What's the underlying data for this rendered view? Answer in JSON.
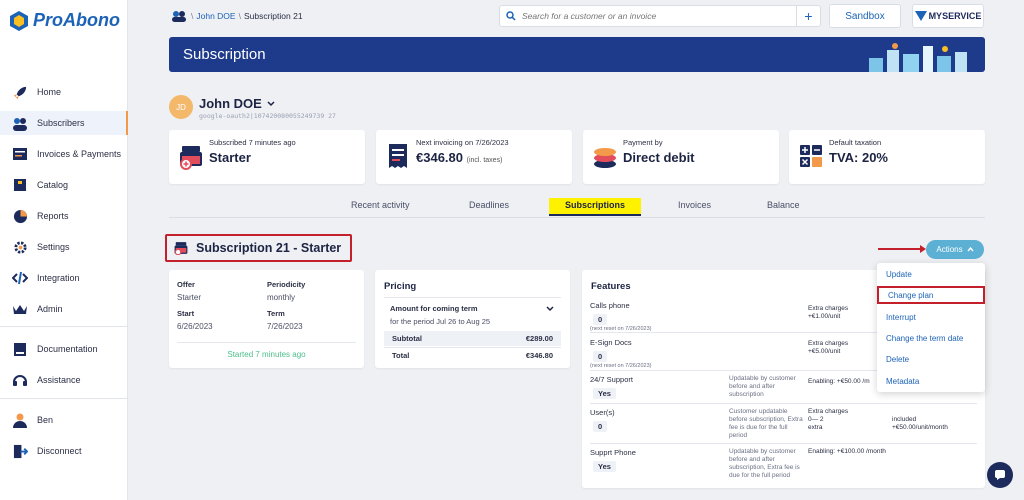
{
  "app": {
    "name": "ProAbono"
  },
  "sidebar": {
    "items": [
      {
        "label": "Home",
        "icon": "rocket-icon"
      },
      {
        "label": "Subscribers",
        "icon": "users-icon"
      },
      {
        "label": "Invoices & Payments",
        "icon": "invoices-icon"
      },
      {
        "label": "Catalog",
        "icon": "catalog-icon"
      },
      {
        "label": "Reports",
        "icon": "pie-chart-icon"
      },
      {
        "label": "Settings",
        "icon": "gear-icon"
      },
      {
        "label": "Integration",
        "icon": "code-icon"
      },
      {
        "label": "Admin",
        "icon": "crown-icon"
      }
    ],
    "help": [
      {
        "label": "Documentation",
        "icon": "book-icon"
      },
      {
        "label": "Assistance",
        "icon": "headset-icon"
      }
    ],
    "account": [
      {
        "label": "Ben",
        "icon": "user-icon"
      },
      {
        "label": "Disconnect",
        "icon": "logout-icon"
      }
    ],
    "active_index": 1
  },
  "header": {
    "breadcrumb": {
      "link": "John DOE",
      "current": "Subscription 21",
      "sep": "\\"
    },
    "search_placeholder": "Search for a customer or an invoice",
    "sandbox_label": "Sandbox",
    "brand_label": "MYSERVICE"
  },
  "banner": {
    "title": "Subscription"
  },
  "customer": {
    "initials": "JD",
    "name": "John DOE",
    "id": "google-oauth2|107420080055249739 27"
  },
  "info_cards": [
    {
      "label": "Subscribed 7 minutes ago",
      "value": "Starter",
      "suffix": ""
    },
    {
      "label": "Next invoicing on 7/26/2023",
      "value": "€346.80",
      "suffix": "(incl. taxes)"
    },
    {
      "label": "Payment by",
      "value": "Direct debit",
      "suffix": ""
    },
    {
      "label": "Default taxation",
      "value": "TVA: 20%",
      "suffix": ""
    }
  ],
  "tabs": [
    "Recent activity",
    "Deadlines",
    "Subscriptions",
    "Invoices",
    "Balance"
  ],
  "active_tab": "Subscriptions",
  "subscription": {
    "title": "Subscription 21 - Starter",
    "actions_label": "Actions",
    "offer_label": "Offer",
    "offer": "Starter",
    "periodicity_label": "Periodicity",
    "periodicity": "monthly",
    "start_label": "Start",
    "start": "6/26/2023",
    "term_label": "Term",
    "term": "7/26/2023",
    "started": "Started 7 minutes ago"
  },
  "pricing": {
    "title": "Pricing",
    "amount_label": "Amount for coming term",
    "period": "for the period Jul 26 to Aug 25",
    "subtotal_label": "Subtotal",
    "subtotal": "€289.00",
    "total_label": "Total",
    "total": "€346.80"
  },
  "features": {
    "title": "Features",
    "rows": [
      {
        "name": "Calls phone",
        "value": "0",
        "note": "(next reset on 7/26/2023)",
        "desc": "",
        "extra": "Extra charges\n+€1.00/unit",
        "extra2": ""
      },
      {
        "name": "E-Sign Docs",
        "value": "0",
        "note": "(next reset on 7/26/2023)",
        "desc": "",
        "extra": "Extra charges\n+€5.00/unit",
        "extra2": ""
      },
      {
        "name": "24/7 Support",
        "value": "Yes",
        "note": "",
        "desc": "Updatable by customer before and after subscription",
        "extra": "Enabling:  +€50.00  /m",
        "extra2": ""
      },
      {
        "name": "User(s)",
        "value": "0",
        "note": "",
        "desc": "Customer updatable before subscription, Extra fee is due for the full period",
        "extra": "Extra charges\n0— 2\nextra",
        "extra2": "\nincluded\n+€50.00/unit/month"
      },
      {
        "name": "Supprt Phone",
        "value": "Yes",
        "note": "",
        "desc": "Updatable by customer before and after subscription, Extra fee is due for the full period",
        "extra": "Enabling:  +€100.00  /month",
        "extra2": ""
      }
    ]
  },
  "actions_menu": [
    "Update",
    "Change plan",
    "Interrupt",
    "Change the term date",
    "Delete",
    "Metadata"
  ],
  "highlighted_action": "Change plan",
  "colors": {
    "brand": "#1c63b7",
    "banner": "#1e3a8a",
    "highlight": "#c4202b",
    "tab_highlight": "#fff200",
    "actions": "#5bb0d4"
  }
}
